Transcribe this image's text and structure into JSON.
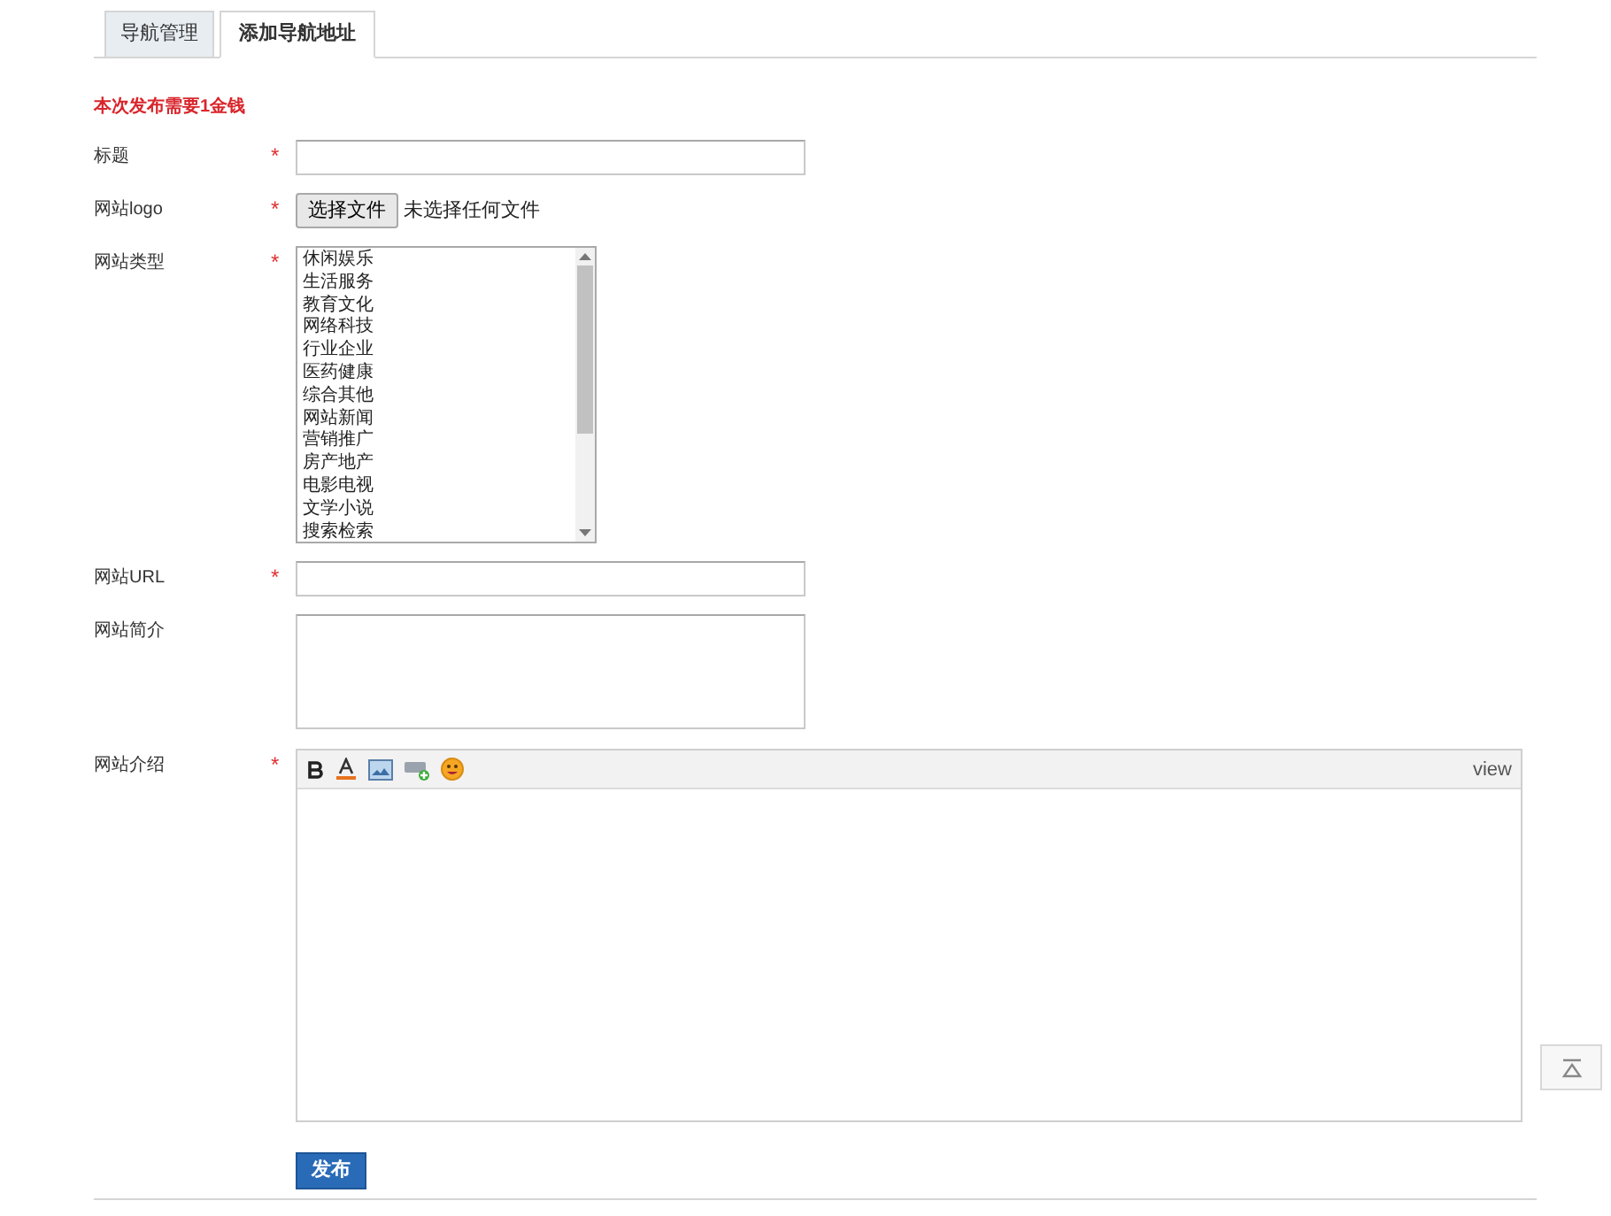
{
  "tabs": [
    {
      "label": "导航管理",
      "selected": false
    },
    {
      "label": "添加导航地址",
      "selected": true
    }
  ],
  "notice": "本次发布需要1金钱",
  "fields": [
    {
      "kind": "text",
      "label": "标题",
      "required_mark": "*"
    },
    {
      "kind": "file",
      "label": "网站logo",
      "required_mark": "*",
      "button": "选择文件",
      "status": "未选择任何文件"
    },
    {
      "kind": "listbox",
      "label": "网站类型",
      "required_mark": "*",
      "options": [
        "休闲娱乐",
        "生活服务",
        "教育文化",
        "网络科技",
        "行业企业",
        "医药健康",
        "综合其他",
        "网站新闻",
        "营销推广",
        "房产地产",
        "电影电视",
        "文学小说",
        "搜索检索"
      ]
    },
    {
      "kind": "text",
      "label": "网站URL",
      "required_mark": "*"
    },
    {
      "kind": "textarea",
      "label": "网站简介"
    },
    {
      "kind": "editor",
      "label": "网站介绍",
      "required_mark": "*",
      "toolbar_toggle": "view"
    }
  ],
  "submit": "发布"
}
